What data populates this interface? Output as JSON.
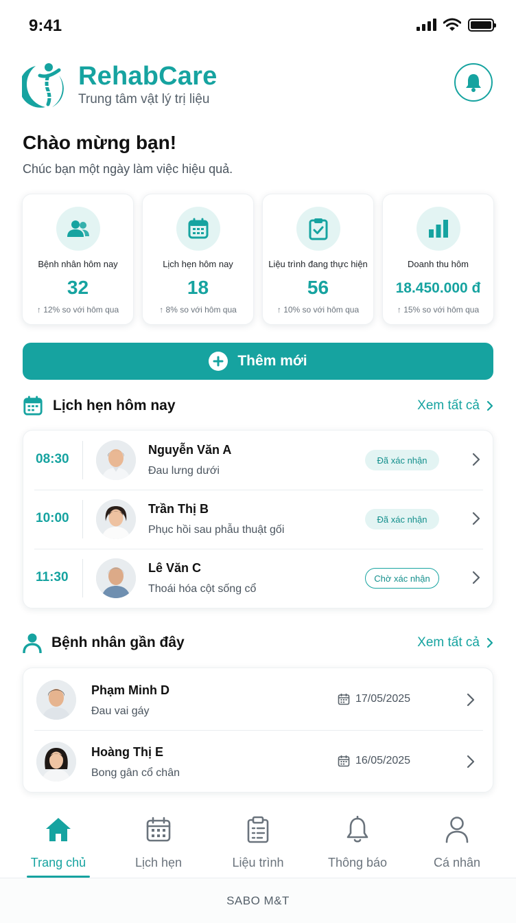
{
  "status_bar": {
    "time": "9:41"
  },
  "brand": {
    "name": "RehabCare",
    "tagline": "Trung tâm vật lý trị liệu"
  },
  "welcome": {
    "title": "Chào mừng bạn!",
    "subtitle": "Chúc bạn một ngày làm việc hiệu quả."
  },
  "stats": [
    {
      "icon": "people-icon",
      "label": "Bệnh nhân hôm nay",
      "value": "32",
      "change": "↑ 12% so với hôm qua"
    },
    {
      "icon": "calendar-icon",
      "label": "Lịch hẹn hôm nay",
      "value": "18",
      "change": "↑ 8% so với hôm qua"
    },
    {
      "icon": "clipboard-check-icon",
      "label": "Liệu trình đang thực hiện",
      "value": "56",
      "change": "↑ 10% so với hôm qua"
    },
    {
      "icon": "bar-chart-icon",
      "label": "Doanh thu hôm",
      "value": "18.450.000 đ",
      "change": "↑ 15% so với hôm qua"
    }
  ],
  "add_button": {
    "label": "Thêm mới"
  },
  "appointments": {
    "title": "Lịch hẹn hôm nay",
    "see_all": "Xem tất cả",
    "items": [
      {
        "time": "08:30",
        "name": "Nguyễn Văn A",
        "desc": "Đau lưng dưới",
        "status": "Đã xác nhận"
      },
      {
        "time": "10:00",
        "name": "Trần Thị B",
        "desc": "Phục hồi sau phẫu thuật gối",
        "status": "Đã xác nhận"
      },
      {
        "time": "11:30",
        "name": "Lê Văn C",
        "desc": "Thoái hóa cột sống cổ",
        "status": "Chờ xác nhận"
      }
    ]
  },
  "recent_patients": {
    "title": "Bệnh nhân gần đây",
    "see_all": "Xem tất cả",
    "items": [
      {
        "name": "Phạm Minh D",
        "desc": "Đau vai gáy",
        "date": "17/05/2025"
      },
      {
        "name": "Hoàng Thị E",
        "desc": "Bong gân cổ chân",
        "date": "16/05/2025"
      }
    ]
  },
  "bottom_nav": [
    {
      "label": "Trang chủ",
      "icon": "home-icon",
      "active": true
    },
    {
      "label": "Lịch hẹn",
      "icon": "calendar-icon",
      "active": false
    },
    {
      "label": "Liệu trình",
      "icon": "clipboard-icon",
      "active": false
    },
    {
      "label": "Thông báo",
      "icon": "bell-icon",
      "active": false
    },
    {
      "label": "Cá nhân",
      "icon": "user-icon",
      "active": false
    }
  ],
  "footer": {
    "text": "SABO M&T"
  },
  "colors": {
    "accent": "#16a3a0",
    "accent_light": "#e3f4f3",
    "text": "#1f2328",
    "muted": "#6a737c"
  }
}
